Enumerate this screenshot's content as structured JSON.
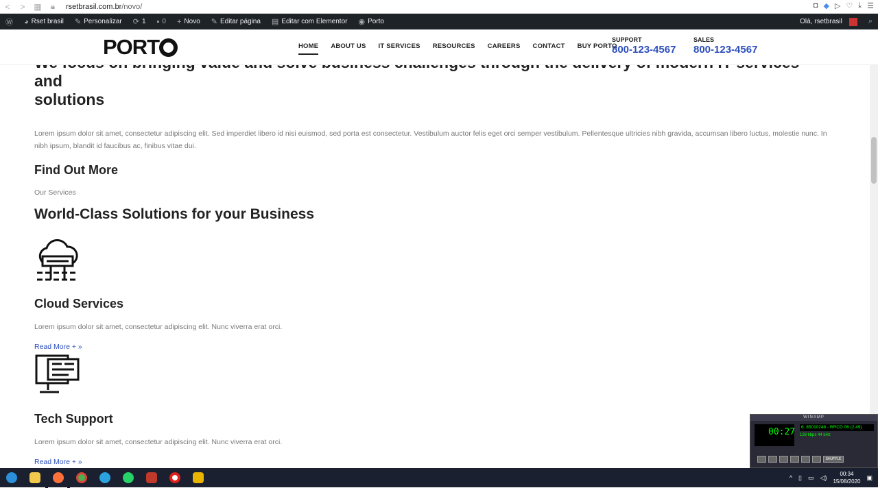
{
  "browser": {
    "url_domain": "rsetbrasil.com.br",
    "url_path": "/novo/"
  },
  "wp_admin_bar": {
    "items": [
      {
        "icon": "wordpress-icon",
        "label": ""
      },
      {
        "icon": "gauge-icon",
        "label": "Rset brasil"
      },
      {
        "icon": "brush-icon",
        "label": "Personalizar"
      },
      {
        "icon": "refresh-icon",
        "label": "1"
      },
      {
        "icon": "comment-icon",
        "label": "0"
      },
      {
        "icon": "plus-icon",
        "label": "Novo"
      },
      {
        "icon": "pencil-icon",
        "label": "Editar página"
      },
      {
        "icon": "elementor-icon",
        "label": "Editar com Elementor"
      },
      {
        "icon": "porto-icon",
        "label": "Porto"
      }
    ],
    "greeting": "Olá, rsetbrasil"
  },
  "header": {
    "logo": "PORTO",
    "nav": [
      "HOME",
      "ABOUT US",
      "IT SERVICES",
      "RESOURCES",
      "CAREERS",
      "CONTACT",
      "BUY PORTO"
    ],
    "support_label": "SUPPORT",
    "support_phone": "800-123-4567",
    "sales_label": "SALES",
    "sales_phone": "800-123-4567"
  },
  "content": {
    "hero_line1": "We focus on bringing value and solve business challenges through the delivery of modern IT services and",
    "hero_line2": "solutions",
    "paragraph": "Lorem ipsum dolor sit amet, consectetur adipiscing elit. Sed imperdiet libero id nisi euismod, sed porta est consectetur. Vestibulum auctor felis eget orci semper vestibulum. Pellentesque ultricies nibh gravida, accumsan libero luctus, molestie nunc. In nibh ipsum, blandit id faucibus ac, finibus vitae dui.",
    "find_out_more": "Find Out More",
    "our_services": "Our Services",
    "section_title": "World-Class Solutions for your Business",
    "services": [
      {
        "icon": "cloud-server-icon",
        "title": "Cloud Services",
        "text": "Lorem ipsum dolor sit amet, consectetur adipiscing elit. Nunc viverra erat orci.",
        "link": "Read More + »"
      },
      {
        "icon": "computer-monitor-icon",
        "title": "Tech Support",
        "text": "Lorem ipsum dolor sit amet, consectetur adipiscing elit. Nunc viverra erat orci.",
        "link": "Read More + »"
      }
    ]
  },
  "winamp": {
    "title": "WINAMP",
    "time": "00:27",
    "song": "6. 85010248 - RRCD 06 (2:49)",
    "kbps": "128",
    "khz": "44",
    "shuffle": "SHUFFLE"
  },
  "taskbar": {
    "time": "00:34",
    "date": "15/08/2020"
  }
}
